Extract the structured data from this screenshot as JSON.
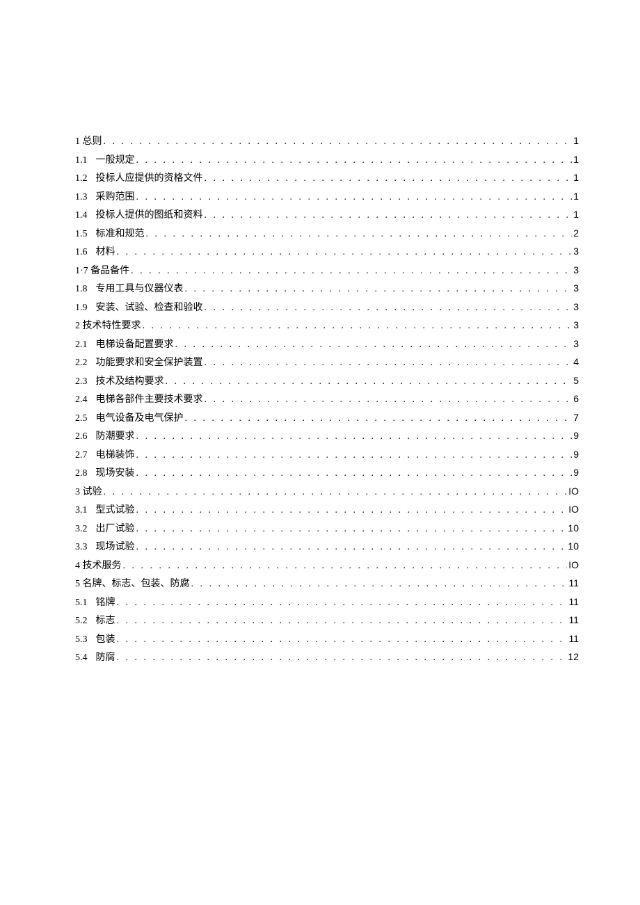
{
  "toc": [
    {
      "num": "1",
      "title": "总则",
      "page": "1",
      "level": 0
    },
    {
      "num": "1.1",
      "title": "一般规定",
      "page": "1",
      "level": 1
    },
    {
      "num": "1.2",
      "title": "投标人应提供的资格文件",
      "page": "1",
      "level": 1
    },
    {
      "num": "1.3",
      "title": "采购范围",
      "page": "1",
      "level": 1
    },
    {
      "num": "1.4",
      "title": "投标人提供的图纸和资料",
      "page": "1",
      "level": 1
    },
    {
      "num": "1.5",
      "title": "标准和规范",
      "page": "2",
      "level": 1
    },
    {
      "num": "1.6",
      "title": "材料",
      "page": "3",
      "level": 1
    },
    {
      "num": "1·7",
      "title": "备品备件",
      "page": "3",
      "level": 0
    },
    {
      "num": "1.8",
      "title": "专用工具与仪器仪表",
      "page": "3",
      "level": 1
    },
    {
      "num": "1.9",
      "title": "安装、试验、检查和验收",
      "page": "3",
      "level": 1
    },
    {
      "num": "2",
      "title": "技术特性要求",
      "page": "3",
      "level": 0
    },
    {
      "num": "2.1",
      "title": "电梯设备配置要求",
      "page": "3",
      "level": 1
    },
    {
      "num": "2.2",
      "title": "功能要求和安全保护装置",
      "page": "4",
      "level": 1
    },
    {
      "num": "2.3",
      "title": "技术及结构要求",
      "page": "5",
      "level": 1
    },
    {
      "num": "2.4",
      "title": "电梯各部件主要技术要求",
      "page": "6",
      "level": 1
    },
    {
      "num": "2.5",
      "title": "电气设备及电气保护",
      "page": "7",
      "level": 1
    },
    {
      "num": "2.6",
      "title": "防潮要求",
      "page": "9",
      "level": 1
    },
    {
      "num": "2.7",
      "title": "电梯装饰",
      "page": "9",
      "level": 1
    },
    {
      "num": "2.8",
      "title": "现场安装",
      "page": "9",
      "level": 1
    },
    {
      "num": "3",
      "title": "试验",
      "page": "IO",
      "level": 0
    },
    {
      "num": "3.1",
      "title": "型式试验",
      "page": "IO",
      "level": 1
    },
    {
      "num": "3.2",
      "title": "出厂试验",
      "page": "10",
      "level": 1
    },
    {
      "num": "3.3",
      "title": "现场试验",
      "page": "10",
      "level": 1
    },
    {
      "num": "4",
      "title": "技术服务",
      "page": "IO",
      "level": 0
    },
    {
      "num": "5",
      "title": "名牌、标志、包装、防腐",
      "page": "11",
      "level": 0
    },
    {
      "num": "5.1",
      "title": "铭牌",
      "page": "11",
      "level": 1
    },
    {
      "num": "5.2",
      "title": "标志",
      "page": "11",
      "level": 1
    },
    {
      "num": "5.3",
      "title": "包装",
      "page": "11",
      "level": 1
    },
    {
      "num": "5.4",
      "title": "防腐",
      "page": "12",
      "level": 1
    }
  ]
}
